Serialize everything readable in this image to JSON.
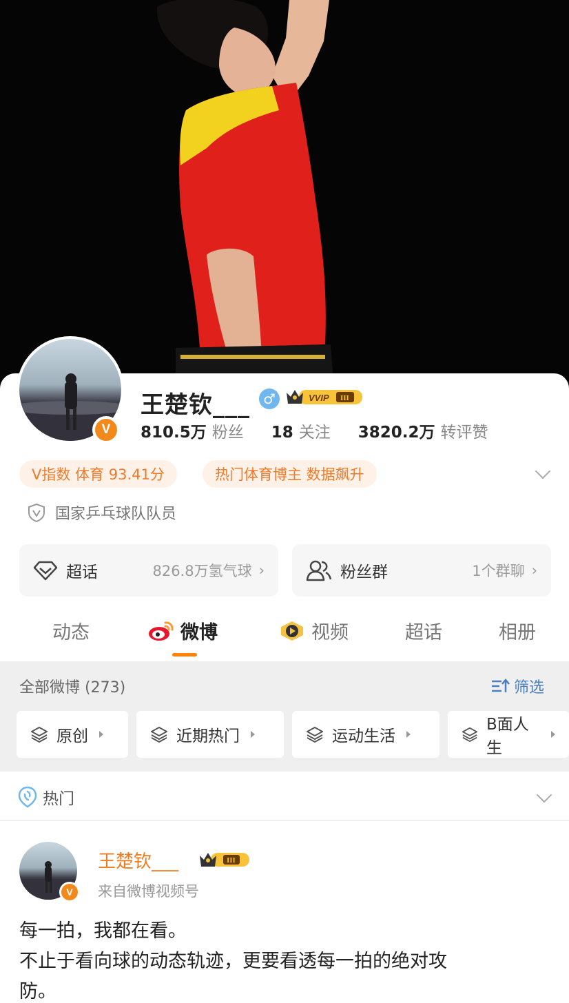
{
  "profile": {
    "name": "王楚钦___",
    "gender_symbol": "♂",
    "vvip_label": "VVIP",
    "vvip_level": "III",
    "verified_mark": "V",
    "stats": [
      {
        "value": "810.5万",
        "label": "粉丝"
      },
      {
        "value": "18",
        "label": "关注"
      },
      {
        "value": "3820.2万",
        "label": "转评赞"
      }
    ],
    "tags": [
      "V指数 体育 93.41分",
      "热门体育博主 数据飙升"
    ],
    "certification": "国家乒乓球队队员"
  },
  "links": {
    "supertopic": {
      "label": "超话",
      "value": "826.8万氢气球"
    },
    "fangroup": {
      "label": "粉丝群",
      "value": "1个群聊"
    }
  },
  "tabs": [
    "动态",
    "微博",
    "视频",
    "超话",
    "相册"
  ],
  "feed": {
    "all_label": "全部微博 (273)",
    "filter_label": "筛选",
    "chips": [
      "原创",
      "近期热门",
      "运动生活",
      "B面人生"
    ],
    "hot_label": "热门"
  },
  "post": {
    "author": "王楚钦___",
    "crown_level": "III",
    "source": "来自微博视频号",
    "text_line1": "每一拍，我都在看。",
    "text_line2": "不止于看向球的动态轨迹，更要看透每一拍的绝对攻",
    "text_line3": "防。"
  },
  "colors": {
    "accent": "#ff8200",
    "tag_text": "#ef7a2a",
    "tag_bg": "#fdf1e8",
    "link_blue": "#4a7fc1",
    "jersey_red": "#e0201a",
    "jersey_yellow": "#f2d21e"
  }
}
